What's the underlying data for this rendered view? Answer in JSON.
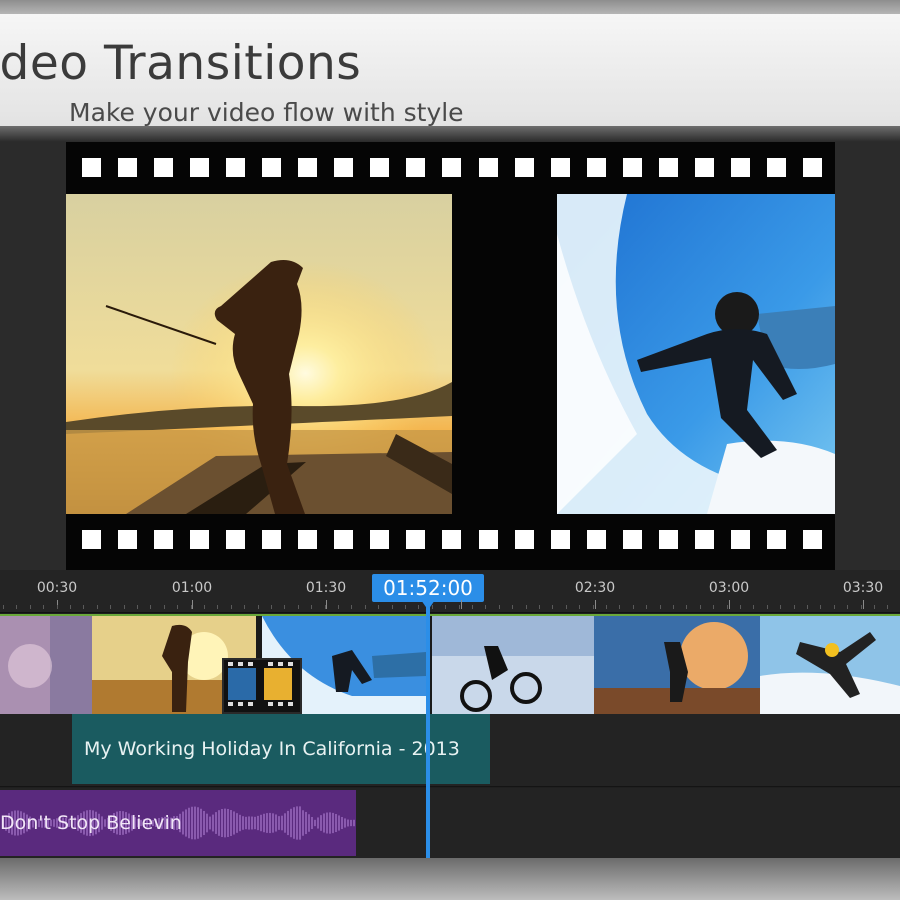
{
  "banner": {
    "title": "ideo Transitions",
    "subtitle": "Make your video flow with style"
  },
  "preview": {
    "frames": [
      {
        "name": "fisherman-at-sunset",
        "colors": {
          "sky": "#d9c98a",
          "sun": "#fff3b0"
        }
      },
      {
        "name": "surfer-in-wave",
        "colors": {
          "sky": "#2f8fe0",
          "water": "#5cc0f0"
        }
      }
    ]
  },
  "timeline": {
    "ruler_labels": [
      "00:30",
      "01:00",
      "01:30",
      "02:30",
      "03:00",
      "03:30"
    ],
    "current_time": "01:52:00",
    "title_clip": "My Working Holiday In California - 2013",
    "audio_clip": "Don't Stop Believin",
    "colors": {
      "accent": "#2b8ee8",
      "title_clip": "#1a5b60",
      "audio_clip": "#5a2a7e",
      "track_border": "#6aa83a"
    }
  }
}
